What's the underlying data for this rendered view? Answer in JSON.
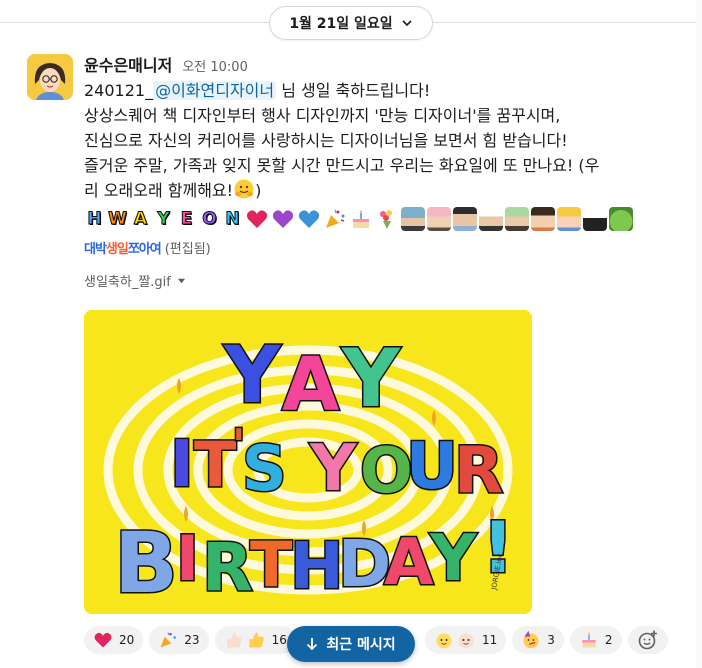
{
  "date_divider": {
    "label": "1월 21일 일요일"
  },
  "message": {
    "author": "윤수은매니저",
    "time": "오전 10:00",
    "line1_prefix": "240121_",
    "mention": "@이화연디자이너",
    "line1_suffix": " 님 생일 축하드립니다!",
    "line2": "상상스퀘어 책 디자인부터 행사 디자인까지 '만능 디자이너'를 꿈꾸시며,",
    "line3": "진심으로 자신의 커리어를 사랑하시는 디자이너님을 보면서 힘 받습니다!",
    "line4": "즐거운 주말, 가족과 잊지 못할 시간 만드시고 우리는 화요일에 또 만나요! (우",
    "line5": "리 오래오래 함께해요!",
    "line5_close": ")",
    "hwayeon_letters": [
      "H",
      "W",
      "A",
      "Y",
      "E",
      "O",
      "N"
    ],
    "hwayeon_colors": [
      "#4aa3ff",
      "#ff8a00",
      "#ffd400",
      "#3fd15c",
      "#ff4fa3",
      "#9b5cff",
      "#35c7ff"
    ],
    "daebak_parts": [
      "대박",
      "생일",
      "쪼아여"
    ],
    "edited_label": "(편집됨)",
    "file_name": "생일축하_짤.gif"
  },
  "gif": {
    "yay": [
      "Y",
      "A",
      "Y"
    ],
    "yay_colors": [
      "#3b4fe0",
      "#f5459b",
      "#41c48e"
    ],
    "its": [
      "I",
      "T",
      "'",
      "S"
    ],
    "its_colors": [
      "#4a4ae0",
      "#e85a3a",
      "#e85a3a",
      "#31b0e0"
    ],
    "your": [
      "Y",
      "O",
      "U",
      "R"
    ],
    "your_colors": [
      "#f178a8",
      "#56b54a",
      "#2d7be0",
      "#e3493c"
    ],
    "birthday": [
      "B",
      "I",
      "R",
      "T",
      "H",
      "D",
      "A",
      "Y",
      "!"
    ],
    "birthday_colors": [
      "#7fa7e8",
      "#f0486a",
      "#36b36a",
      "#ef6a2a",
      "#3a5bd9",
      "#7fa7e8",
      "#f0486a",
      "#36b36a",
      "#41c0e0"
    ],
    "signature": "JORGIE.inc"
  },
  "reactions": [
    {
      "icon": "red-heart-icon",
      "count": "20"
    },
    {
      "icon": "party-popper-icon",
      "count": "23"
    },
    {
      "icon": "thumbs-up-icon",
      "count": "16"
    },
    {
      "icon": "baby-faces-icon",
      "count": "11"
    },
    {
      "icon": "partying-face-icon",
      "count": "3"
    },
    {
      "icon": "birthday-cake-icon",
      "count": "2"
    }
  ],
  "jump_button": {
    "label": "최근 메시지"
  },
  "colors": {
    "accent": "#1264a3",
    "mention_bg": "#e8f4fb",
    "mention_fg": "#1264a3",
    "gif_bg": "#f7e61c"
  }
}
